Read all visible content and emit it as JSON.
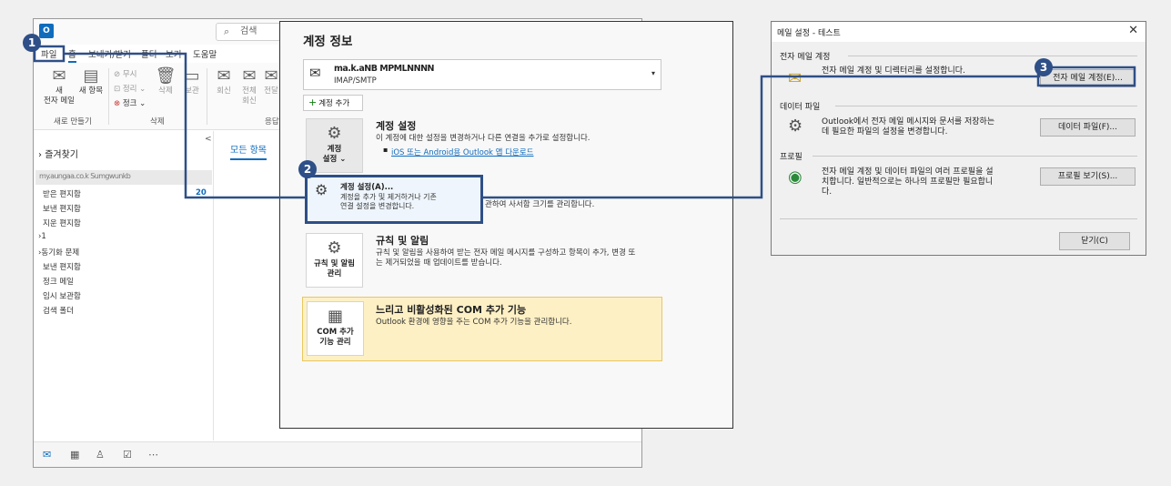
{
  "outlook": {
    "search_placeholder": "검색",
    "tabs": [
      "파일",
      "홈",
      "보내기/받기",
      "폴더",
      "보기",
      "도움말"
    ],
    "ribbon": {
      "new_mail": "새\n전자 메일",
      "new_items": "새 항목",
      "ignore": "무시",
      "cleanup": "정리",
      "junk": "정크",
      "delete": "삭제",
      "archive": "보관",
      "reply": "회신",
      "reply_all": "전체\n회신",
      "forward": "전달",
      "group_new": "새로 만들기",
      "group_delete": "삭제",
      "group_respond": "응답"
    },
    "nav": {
      "favorites": "즐겨찾기",
      "account_obscured": "my.aungaa.co.k Sumgwunkb",
      "folders": [
        "받은 편지함",
        "보낸 편지함",
        "지운 편지함",
        "1",
        "동기화 문제",
        "보낸 편지함",
        "정크 메일",
        "임시 보관함",
        "검색 폴더"
      ],
      "inbox_count": "20",
      "collapse": "<"
    },
    "all_items_tab": "모든 항목",
    "bottom_icons": [
      "mail-icon",
      "calendar-icon",
      "people-icon",
      "tasks-icon",
      "more-icon"
    ]
  },
  "account_info": {
    "title": "계정 정보",
    "account_name": "ma.k.aNB MPMLNNNN",
    "account_type": "IMAP/SMTP",
    "add_account": "계정 추가",
    "settings_button": "계정\n설정 ⌄",
    "settings_title": "계정 설정",
    "settings_desc": "이 계정에 대한 설정을 변경하거나 다른 연결을 추가로 설정합니다.",
    "settings_link": "iOS 또는 Android용 Outlook 앱 다운로드",
    "popup_title": "계정 설정(A)...",
    "popup_desc": "계정을 추가 및 제거하거나 기존\n연결 설정을 변경합니다.",
    "cleanup_desc_partial": "관하여 사서함 크기를 관리합니다.",
    "rules_button": "규칙 및 알림\n관리",
    "rules_title": "규칙 및 알림",
    "rules_desc": "규칙 및 알림을 사용하여 받는 전자 메일 메시지를 구성하고 항목이 추가, 변경 또\n는 제거되었을 때 업데이트를 받습니다.",
    "com_button": "COM 추가\n기능 관리",
    "com_title": "느리고 비활성화된 COM 추가 기능",
    "com_desc": "Outlook 환경에 영향을 주는 COM 추가 기능을 관리합니다."
  },
  "mail_setup": {
    "title": "메일 설정 - 테스트",
    "email_group": "전자 메일 계정",
    "email_desc": "전자 메일 계정 및 디렉터리를 설정합니다.",
    "email_button": "전자 메일 계정(E)...",
    "data_group": "데이터 파일",
    "data_desc": "Outlook에서 전자 메일 메시지와 문서를 저장하는\n데 필요한 파일의 설정을 변경합니다.",
    "data_button": "데이터 파일(F)...",
    "profile_group": "프로필",
    "profile_desc": "전자 메일 계정 및 데이터 파일의 여러 프로필을 설\n치합니다. 일반적으로는 하나의 프로필만 필요합니\n다.",
    "profile_button": "프로필 보기(S)...",
    "close_button": "닫기(C)"
  },
  "steps": [
    "1",
    "2",
    "3"
  ],
  "colors": {
    "annotation": "#2e4f87",
    "link": "#0f6cbd",
    "com_bg": "#fdf0c5"
  }
}
